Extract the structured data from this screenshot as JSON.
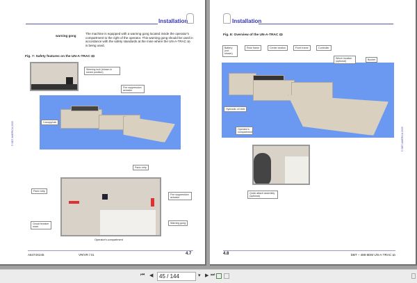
{
  "left_page": {
    "header": "Installation",
    "term": "warning gong",
    "paragraph": "The machine is equipped with a warning gong located inside the operator's compartment to the right of the operator. This warning gong should be used in accordance with the safety standards at the mine where the UN-A-TRAC ꝏ is being used.",
    "figure_caption": "Fig. 7: Safety features on the UN-A-TRAC ꝏ",
    "labels": {
      "steering_lock": "Steering lock (shown in stored position)",
      "fire_top": "Fire suppression actuator",
      "canopy": "Canopy/cab",
      "panic_top": "Panic strip",
      "panic_left": "Panic strip",
      "fire_right": "Fire suppression actuator",
      "circuit": "Circuit breaker reset",
      "gong": "Warning gong"
    },
    "photo_caption": "Operator's compartment",
    "copyright": "© DBT AMERICA 2005",
    "footer": {
      "doc": "A8474X245",
      "rev": "VR/VR / 01",
      "page": "4.7"
    }
  },
  "right_page": {
    "header": "Installation",
    "figure_caption": "Fig. 8: Overview of the UN-A-TRAC ꝏ",
    "labels": {
      "battery": "Battery (not shown)",
      "rear": "Rear frame",
      "center": "Center section",
      "front": "Front frame",
      "controller": "Controller",
      "winch": "Winch location (optional)",
      "bucket": "Bucket",
      "hydraulic": "Hydraulic oil tank",
      "operator": "Operator's compartment",
      "quick": "Quick attach assembly (optional)"
    },
    "copyright": "© DBT AMERICA 2005",
    "footer": {
      "page": "4.8",
      "doc": "DBT – 488-8DM UN-A-TRAC ꝏ"
    }
  },
  "toolbar": {
    "first": "⏮",
    "prev": "◀",
    "page_value": "45 / 144",
    "dropdown": "▾",
    "next": "▶",
    "last": "⏭"
  }
}
